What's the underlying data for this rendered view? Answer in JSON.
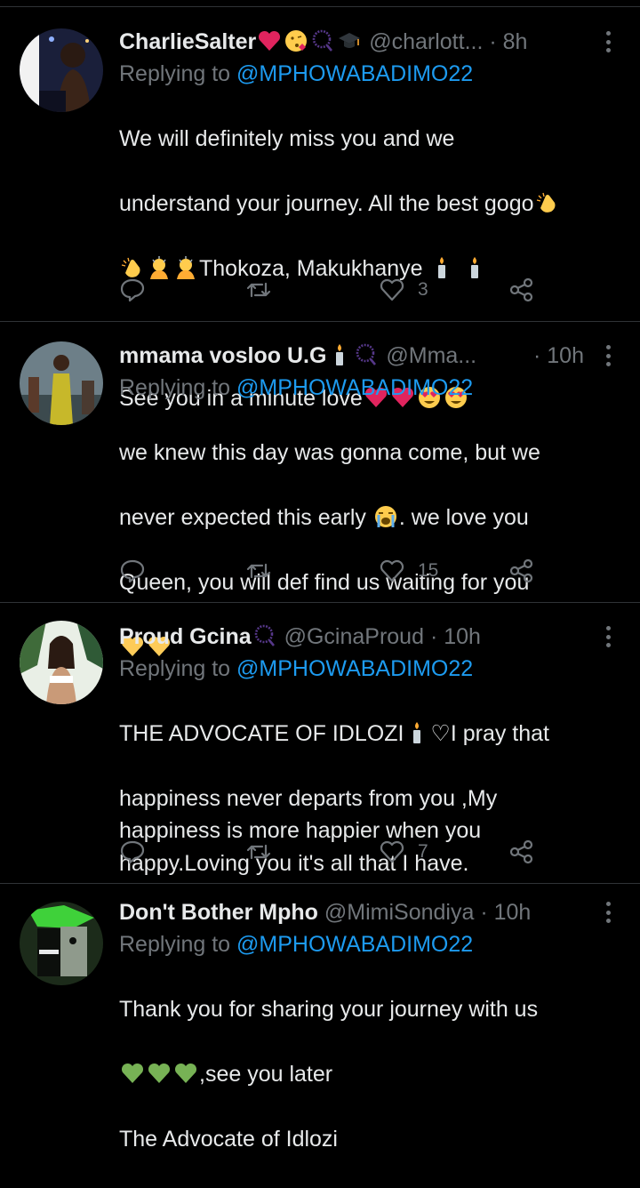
{
  "tweets": [
    {
      "name": "CharlieSalter",
      "name_emoji": [
        "heart",
        "kiss",
        "beads",
        "grad"
      ],
      "handle": "@charlott...",
      "time": "· 8h",
      "replying_label": "Replying to",
      "mention": "@MPHOWABADIMO22",
      "text_segments": [
        "We will definitely miss you and we",
        "understand your journey. All the best gogo"
      ],
      "likes": "3",
      "avatar_icon": "profile-photo"
    },
    {
      "name": "mmama vosloo U.G",
      "name_emoji": [
        "candle",
        "beads"
      ],
      "handle": "@Mma...",
      "time": "· 10h",
      "replying_label": "Replying to",
      "mention": "@MPHOWABADIMO22",
      "text_lines": [
        "we knew this day was gonna come, but we",
        "never expected this early",
        ". we love you",
        "Queen, you will def find us waiting for you"
      ],
      "likes": "15"
    },
    {
      "name": "Proud Gcina",
      "name_emoji": [
        "beads"
      ],
      "handle": "@GcinaProud",
      "time": "· 10h",
      "replying_label": "Replying to",
      "mention": "@MPHOWABADIMO22",
      "text_first": "THE ADVOCATE OF IDLOZI",
      "text_first_after": "♡I pray that",
      "text_rest": "happiness never departs from you ,My\nhappiness is more happier when you\nhappy.Loving you it's all that I have.",
      "likes": "7"
    },
    {
      "name": "Don't Bother Mpho",
      "handle": "@MimiSondiya",
      "time": "· 10h",
      "replying_label": "Replying to",
      "mention": "@MPHOWABADIMO22",
      "text_first": "Thank you for sharing your journey with us",
      "text_emoji_after": ",see you later",
      "text_last": "The Advocate of Idlozi"
    }
  ],
  "tweet1_line3_text": "Thokoza, Makukhanye",
  "tweet1_line4_text": "See you in a minute  love",
  "colors": {
    "background": "#000000",
    "text": "#e7e9ea",
    "muted": "#71767b",
    "link": "#1d9bf0",
    "divider": "#2f3336"
  }
}
